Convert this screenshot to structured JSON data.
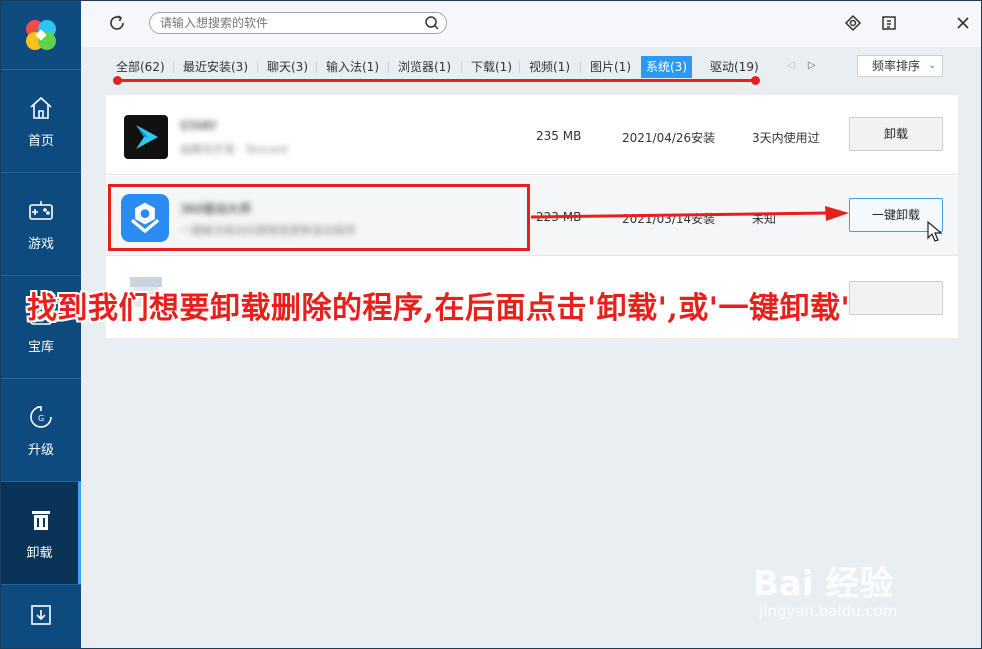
{
  "sidebar": {
    "items": [
      {
        "label": "首页",
        "icon": "home-icon"
      },
      {
        "label": "游戏",
        "icon": "gamepad-icon"
      },
      {
        "label": "宝库",
        "icon": "treasure-icon"
      },
      {
        "label": "升级",
        "icon": "upgrade-icon"
      },
      {
        "label": "卸载",
        "icon": "trash-icon",
        "active": true
      }
    ],
    "bottom_icon": "download-icon"
  },
  "search": {
    "placeholder": "请输入想搜索的软件"
  },
  "tabs": [
    {
      "label": "全部(62)"
    },
    {
      "label": "最近安装(3)"
    },
    {
      "label": "聊天(3)"
    },
    {
      "label": "输入法(1)"
    },
    {
      "label": "浏览器(1)"
    },
    {
      "label": "下载(1)"
    },
    {
      "label": "视频(1)"
    },
    {
      "label": "图片(1)"
    },
    {
      "label": "系统(3)",
      "active": true
    },
    {
      "label": "驱动(19)"
    }
  ],
  "sort": {
    "label": "频率排序"
  },
  "apps": [
    {
      "name": "STARY",
      "desc": "由腾讯开发 · Tencent",
      "size": "235 MB",
      "date": "2021/04/26安装",
      "usage": "3天内使用过",
      "button": "卸载"
    },
    {
      "name": "360驱动大师",
      "desc": "一键解决驱动问题智能更新驱动程序",
      "size": "223 MB",
      "date": "2021/03/14安装",
      "usage": "未知",
      "button": "一键卸载"
    }
  ],
  "annotation": {
    "caption": "找到我们想要卸载删除的程序,在后面点击'卸载',或'一键卸载'"
  },
  "watermark": {
    "brand": "Bai 经验",
    "url": "jingyan.baidu.com"
  },
  "colors": {
    "sidebar": "#0d4a7d",
    "accent": "#2b9af3",
    "annotation": "#e8201c"
  }
}
